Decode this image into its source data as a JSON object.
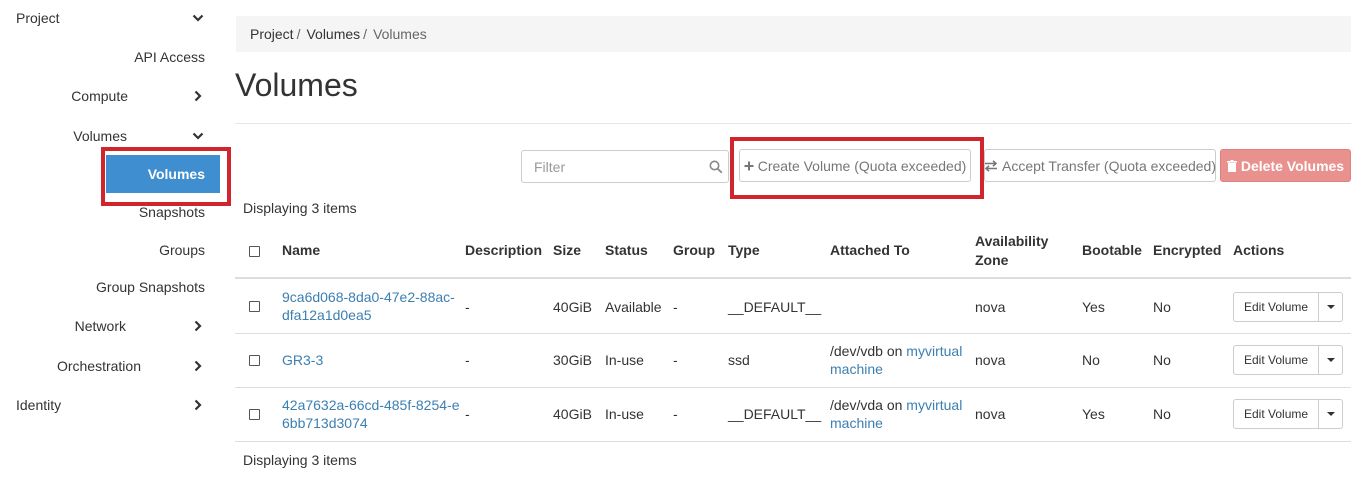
{
  "sidebar": {
    "project": "Project",
    "api_access": "API Access",
    "compute": "Compute",
    "volumes_group": "Volumes",
    "volumes_active": "Volumes",
    "snapshots": "Snapshots",
    "groups": "Groups",
    "group_snapshots": "Group Snapshots",
    "network": "Network",
    "orchestration": "Orchestration",
    "identity": "Identity"
  },
  "breadcrumb": {
    "items": [
      "Project",
      "Volumes",
      "Volumes"
    ],
    "separator": "/"
  },
  "page": {
    "title": "Volumes"
  },
  "toolbar": {
    "filter_placeholder": "Filter",
    "create_label": "Create Volume (Quota exceeded)",
    "accept_label": "Accept Transfer (Quota exceeded)",
    "delete_label": "Delete Volumes"
  },
  "display_count": "Displaying 3 items",
  "table": {
    "headers": {
      "name": "Name",
      "description": "Description",
      "size": "Size",
      "status": "Status",
      "group": "Group",
      "type": "Type",
      "attached_to": "Attached To",
      "az_line1": "Availability",
      "az_line2": "Zone",
      "bootable": "Bootable",
      "encrypted": "Encrypted",
      "actions": "Actions"
    },
    "rows": [
      {
        "name_line1": "9ca6d068-8da0-47e2-88ac-",
        "name_line2": "dfa12a1d0ea5",
        "description": "-",
        "size": "40GiB",
        "status": "Available",
        "group": "-",
        "type": "__DEFAULT__",
        "attached_device": "",
        "attached_on": "",
        "attached_vm_line1": "",
        "attached_vm_line2": "",
        "az": "nova",
        "bootable": "Yes",
        "encrypted": "No",
        "action": "Edit Volume"
      },
      {
        "name_line1": "GR3-3",
        "name_line2": "",
        "description": "-",
        "size": "30GiB",
        "status": "In-use",
        "group": "-",
        "type": "ssd",
        "attached_device": "/dev/vdb",
        "attached_on": "on",
        "attached_vm_line1": "myvirtual",
        "attached_vm_line2": "machine",
        "az": "nova",
        "bootable": "No",
        "encrypted": "No",
        "action": "Edit Volume"
      },
      {
        "name_line1": "42a7632a-66cd-485f-8254-e",
        "name_line2": "6bb713d3074",
        "description": "-",
        "size": "40GiB",
        "status": "In-use",
        "group": "-",
        "type": "__DEFAULT__",
        "attached_device": "/dev/vda",
        "attached_on": "on",
        "attached_vm_line1": "myvirtual",
        "attached_vm_line2": "machine",
        "az": "nova",
        "bootable": "Yes",
        "encrypted": "No",
        "action": "Edit Volume"
      }
    ]
  },
  "colors": {
    "active_nav": "#3e8ed0",
    "link": "#3c7fb1",
    "highlight_box": "#d1252e",
    "delete_button": "#e8918e"
  }
}
